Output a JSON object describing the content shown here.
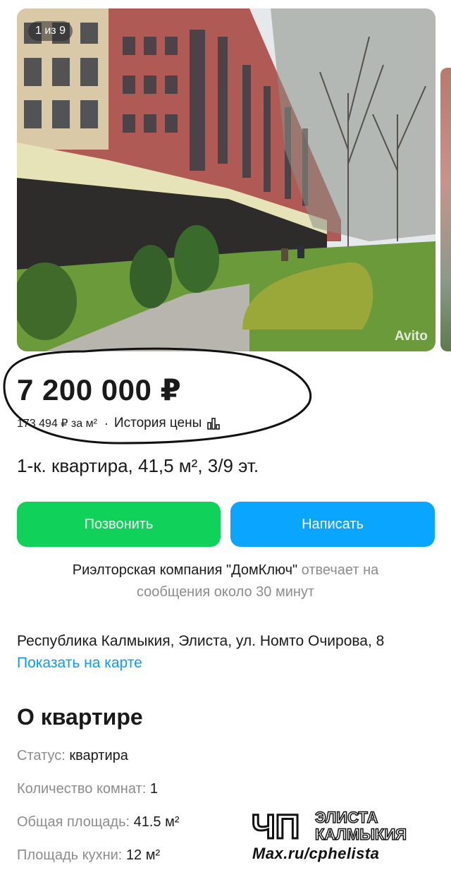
{
  "gallery": {
    "counter": "1 из 9",
    "watermark": "Avito"
  },
  "listing": {
    "price": "7 200 000 ₽",
    "price_per_m2": "173 494 ₽ за м²",
    "separator": "·",
    "price_history": "История цены",
    "title": "1-к. квартира, 41,5 м², 3/9 эт."
  },
  "actions": {
    "call_label": "Позвонить",
    "write_label": "Написать"
  },
  "agent": {
    "name": "Риэлторская компания \"ДомКлюч\"",
    "response_text": "отвечает на",
    "response_time": "сообщения около 30 минут"
  },
  "location": {
    "address": "Республика Калмыкия, Элиста, ул. Номто Очирова, 8",
    "map_link": "Показать на карте"
  },
  "about": {
    "title": "О квартире",
    "params": [
      {
        "key": "Статус:",
        "value": "квартира"
      },
      {
        "key": "Количество комнат:",
        "value": "1"
      },
      {
        "key": "Общая площадь:",
        "value": "41.5 м²"
      },
      {
        "key": "Площадь кухни:",
        "value": "12 м²"
      }
    ]
  },
  "overlay_logo": {
    "mark": "ЧП",
    "line1": "ЭЛИСТА",
    "line2": "КАЛМЫКИЯ",
    "url": "Max.ru/cphelista"
  },
  "colors": {
    "call": "#10d25a",
    "write": "#0aa5ff",
    "link": "#0a9cf5",
    "muted": "#8c8c8c"
  }
}
